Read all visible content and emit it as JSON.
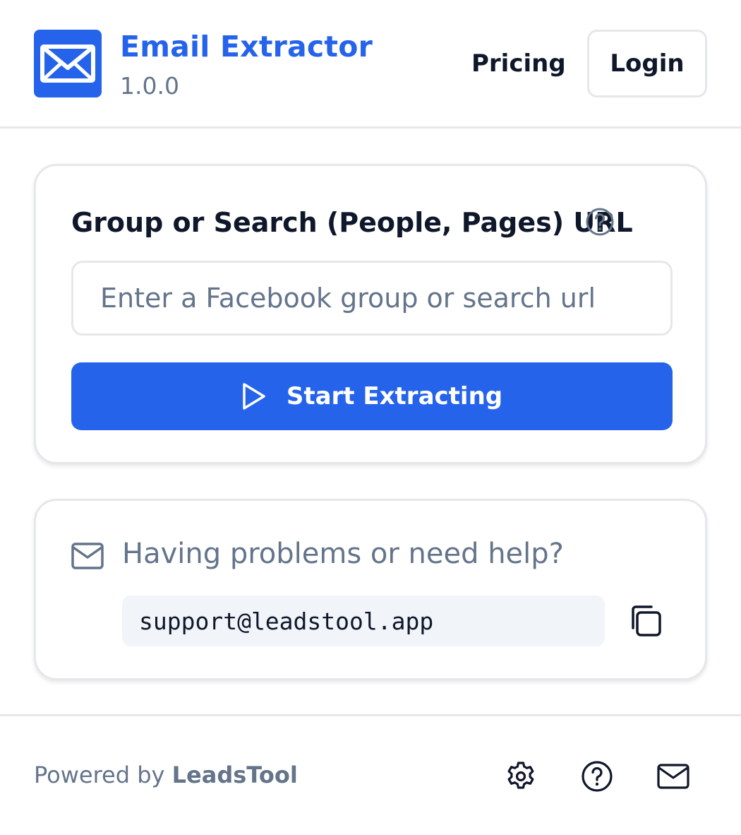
{
  "header": {
    "app_title": "Email Extractor",
    "app_version": "1.0.0",
    "pricing_label": "Pricing",
    "login_label": "Login",
    "logo_icon": "envelope-icon"
  },
  "extract_card": {
    "label": "Group or Search (People, Pages) URL",
    "info_icon": "question-circle-icon",
    "input_value": "",
    "input_placeholder": "Enter a Facebook group or search url",
    "start_button_label": "Start Extracting",
    "start_button_icon": "play-icon"
  },
  "help_card": {
    "icon": "mail-icon",
    "text": "Having problems or need help?",
    "support_email": "support@leadstool.app",
    "copy_icon": "copy-icon"
  },
  "footer": {
    "powered_by": "Powered by",
    "brand": "LeadsTool",
    "icons": [
      "gear-icon",
      "help-circle-icon",
      "mail-icon"
    ]
  },
  "colors": {
    "accent": "#2563eb",
    "text_primary": "#0f172a",
    "text_muted": "#64748b",
    "border": "#e5e7eb",
    "code_bg": "#f1f5f9"
  }
}
